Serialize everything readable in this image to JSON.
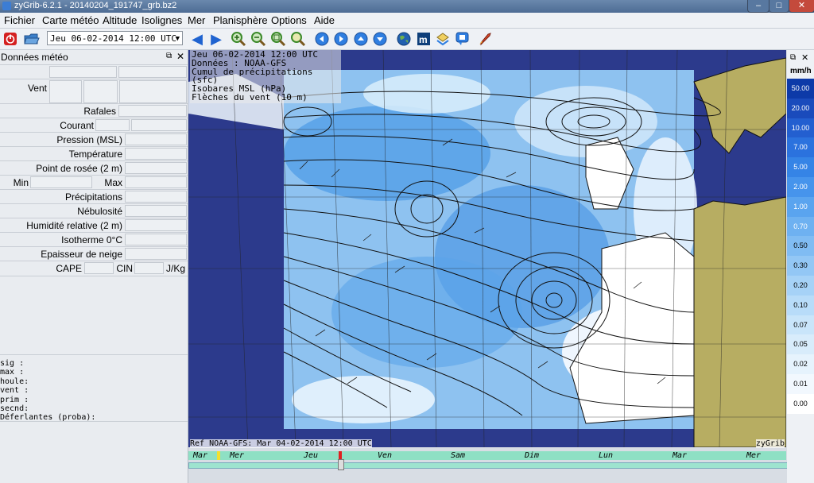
{
  "window": {
    "title": "zyGrib-6.2.1 - 20140204_191747_grb.bz2",
    "controls": {
      "minimize": "–",
      "maximize": "□",
      "close": "✕"
    }
  },
  "menu": [
    "Fichier",
    "Carte météo",
    "Altitude",
    "Isolignes",
    "Mer",
    "Planisphère",
    "Options",
    "Aide"
  ],
  "toolbar": {
    "date_selected": "Jeu 06-02-2014 12:00 UTC",
    "icons": [
      "power-icon",
      "folder-open-icon",
      "arrow-left-icon",
      "arrow-right-icon",
      "zoom-in-icon",
      "zoom-out-icon",
      "zoom-fit-icon",
      "zoom-area-icon",
      "circle-left-icon",
      "circle-right-icon",
      "circle-up-icon",
      "circle-down-icon",
      "earth-icon",
      "meteogram-icon",
      "layers-icon",
      "comment-icon",
      "rocket-icon"
    ]
  },
  "panel": {
    "title": "Données météo",
    "labels": {
      "vent": "Vent",
      "rafales": "Rafales",
      "courant": "Courant",
      "pression": "Pression (MSL)",
      "temperature": "Température",
      "rosee": "Point de rosée (2 m)",
      "min": "Min",
      "max": "Max",
      "precip": "Précipitations",
      "nebulosite": "Nébulosité",
      "humidite": "Humidité relative (2 m)",
      "isotherme": "Isotherme 0°C",
      "neige": "Epaisseur de neige",
      "cape": "CAPE",
      "cin": "CIN",
      "jkg": "J/Kg"
    },
    "waves": [
      "sig  :",
      "max  :",
      "houle:",
      "vent :",
      "prim :",
      "secnd:",
      "Déferlantes (proba):"
    ]
  },
  "map": {
    "info_lines": [
      "Jeu 06-02-2014 12:00 UTC",
      "Données : NOAA-GFS",
      "Cumul de précipitations (sfc)",
      "Isobares MSL (hPa)",
      "Flèches du vent (10 m)"
    ],
    "reference": "Ref NOAA-GFS: Mar 04-02-2014 12:00 UTC",
    "brand": "zyGrib",
    "colors": {
      "ocean": "#2c3a8c",
      "land": "#b7ad62",
      "precip_light": "#cfe6fb",
      "precip_mid": "#5aa4ea"
    }
  },
  "timeline": {
    "days": [
      "Mar",
      "Mer",
      "Jeu",
      "Ven",
      "Sam",
      "Dim",
      "Lun",
      "Mar",
      "Mer"
    ],
    "current_position": 0.25
  },
  "colorbar": {
    "unit": "mm/h",
    "values": [
      "50.00",
      "20.00",
      "10.00",
      "7.00",
      "5.00",
      "2.00",
      "1.00",
      "0.70",
      "0.50",
      "0.30",
      "0.20",
      "0.10",
      "0.07",
      "0.05",
      "0.02",
      "0.01",
      "0.00"
    ],
    "colors": [
      "#0d3aa8",
      "#1a4bbc",
      "#235fd0",
      "#2b72de",
      "#3584e6",
      "#4694ec",
      "#5aa4ef",
      "#6eb1f1",
      "#80bcf3",
      "#93c7f5",
      "#a6d2f7",
      "#b8dcf9",
      "#c9e5fa",
      "#d8ecfb",
      "#e6f3fd",
      "#f2f8fe",
      "#ffffff"
    ]
  }
}
